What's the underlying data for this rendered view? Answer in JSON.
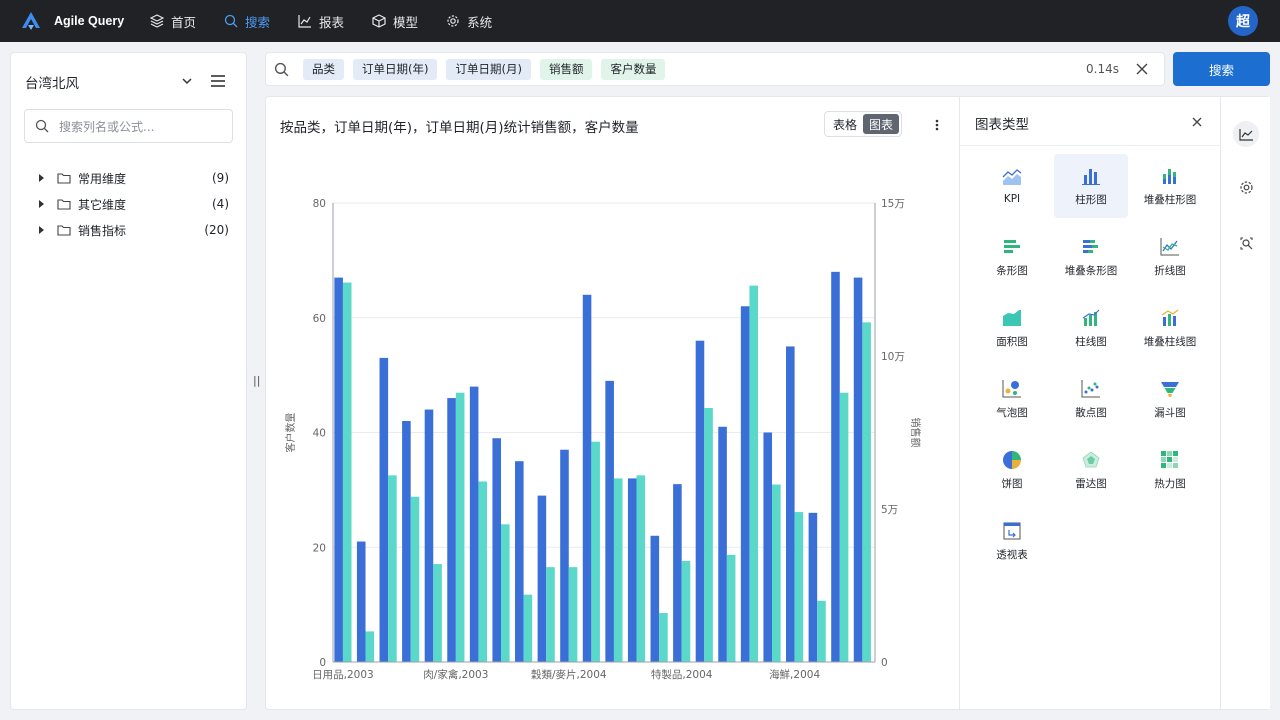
{
  "app": {
    "name": "Agile Query",
    "avatar_text": "超"
  },
  "nav": [
    {
      "label": "首页",
      "icon": "layers-icon"
    },
    {
      "label": "搜索",
      "icon": "search-icon"
    },
    {
      "label": "报表",
      "icon": "chart-icon"
    },
    {
      "label": "模型",
      "icon": "cube-icon"
    },
    {
      "label": "系统",
      "icon": "gear-icon"
    }
  ],
  "sidebar": {
    "datasource": "台湾北风",
    "search_placeholder": "搜索列名或公式...",
    "groups": [
      {
        "label": "常用维度",
        "count": "(9)"
      },
      {
        "label": "其它维度",
        "count": "(4)"
      },
      {
        "label": "销售指标",
        "count": "(20)"
      }
    ]
  },
  "query": {
    "chips": [
      {
        "label": "品类",
        "kind": "dimension"
      },
      {
        "label": "订单日期(年)",
        "kind": "dimension"
      },
      {
        "label": "订单日期(月)",
        "kind": "dimension"
      },
      {
        "label": "销售额",
        "kind": "measure"
      },
      {
        "label": "客户数量",
        "kind": "measure"
      }
    ],
    "time": "0.14s",
    "search_button": "搜索"
  },
  "result": {
    "title": "按品类，订单日期(年)，订单日期(月)统计销售额，客户数量",
    "view_table": "表格",
    "view_chart": "图表"
  },
  "chart_types_panel": {
    "title": "图表类型",
    "selected": "柱形图",
    "items": [
      "KPI",
      "柱形图",
      "堆叠柱形图",
      "条形图",
      "堆叠条形图",
      "折线图",
      "面积图",
      "柱线图",
      "堆叠柱线图",
      "气泡图",
      "散点图",
      "漏斗图",
      "饼图",
      "雷达图",
      "热力图",
      "透视表"
    ]
  },
  "chart_data": {
    "type": "bar",
    "xlabels_shown": [
      "日用品,2003",
      "肉/家禽,2003",
      "穀類/麥片,2004",
      "特製品,2004",
      "海鮮,2004"
    ],
    "y_left": {
      "label": "客户数量",
      "ticks": [
        "0",
        "20",
        "40",
        "60",
        "80"
      ],
      "range": [
        0,
        80
      ]
    },
    "y_right": {
      "label": "销售额",
      "ticks": [
        "0",
        "5万",
        "10万",
        "15万"
      ],
      "range": [
        0,
        150000
      ]
    },
    "colors": {
      "customers": "#3a6fd8",
      "sales": "#5ad8c9"
    },
    "series": [
      {
        "name": "客户数量",
        "axis": "left",
        "values": [
          67,
          21,
          53,
          42,
          44,
          46,
          48,
          39,
          35,
          29,
          37,
          64,
          49,
          32,
          22,
          31,
          56,
          41,
          62,
          40,
          55,
          26,
          68,
          67
        ]
      },
      {
        "name": "销售额",
        "axis": "right",
        "values": [
          124000,
          10000,
          61000,
          54000,
          32000,
          88000,
          59000,
          45000,
          22000,
          31000,
          31000,
          72000,
          60000,
          61000,
          16000,
          33000,
          83000,
          35000,
          123000,
          58000,
          49000,
          20000,
          88000,
          111000
        ]
      }
    ]
  }
}
